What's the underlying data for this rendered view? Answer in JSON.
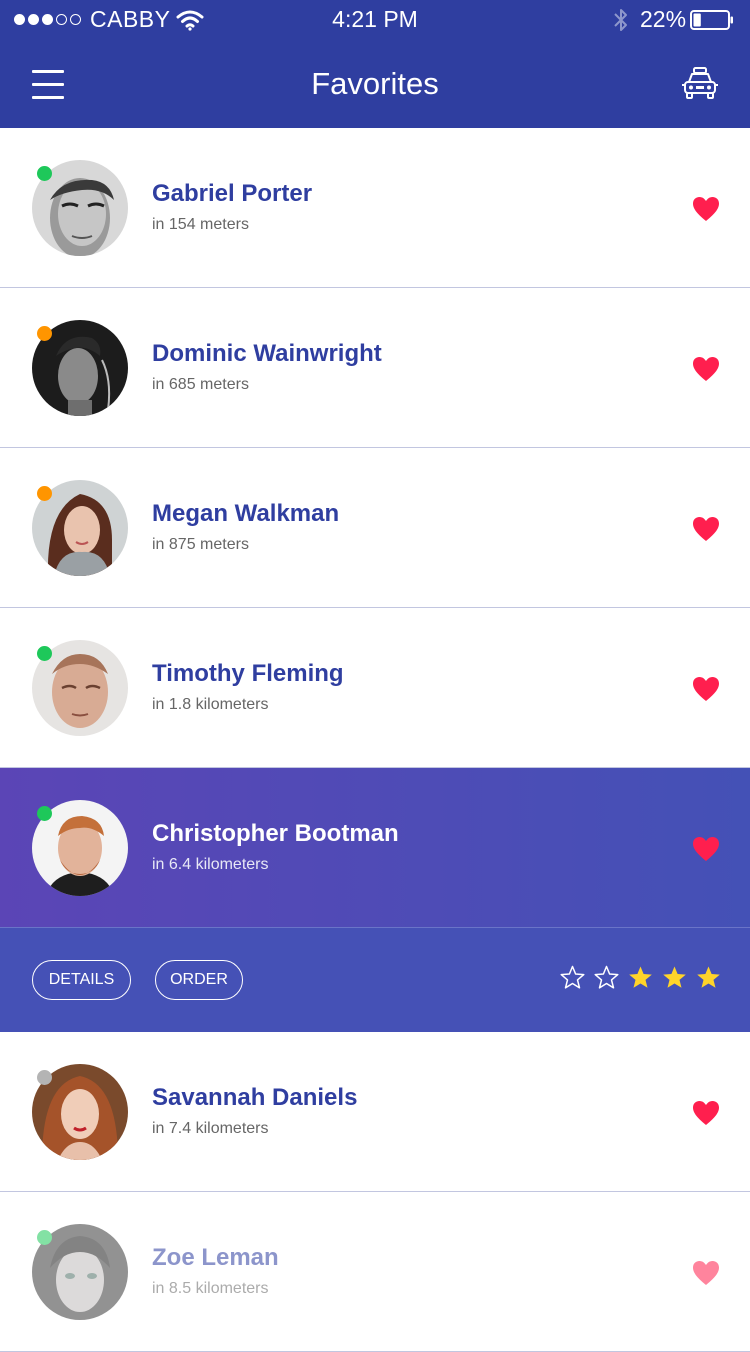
{
  "status_bar": {
    "signal_dots": [
      "full",
      "full",
      "full",
      "empty",
      "empty"
    ],
    "carrier": "CABBY",
    "time": "4:21 PM",
    "battery_percent": "22%",
    "battery_level": 0.22
  },
  "nav": {
    "title": "Favorites",
    "menu_icon": "hamburger-menu-icon",
    "right_icon": "taxi-icon"
  },
  "colors": {
    "primary": "#2f3ea0",
    "selected_gradient": [
      "#5b45b6",
      "#4451b6"
    ],
    "heart": "#ff1f4e",
    "star_filled": "#ffd42a",
    "online": "#1ec85a",
    "away": "#ff9500",
    "offline": "#b4b4b4"
  },
  "drivers": [
    {
      "name": "Gabriel Porter",
      "distance": "in 154 meters",
      "status": "online"
    },
    {
      "name": "Dominic Wainwright",
      "distance": "in 685 meters",
      "status": "away"
    },
    {
      "name": "Megan Walkman",
      "distance": "in 875 meters",
      "status": "away"
    },
    {
      "name": "Timothy Fleming",
      "distance": "in 1.8 kilometers",
      "status": "online"
    },
    {
      "name": "Christopher Bootman",
      "distance": "in 6.4 kilometers",
      "status": "online",
      "selected": true
    },
    {
      "name": "Savannah Daniels",
      "distance": "in 7.4 kilometers",
      "status": "offline"
    },
    {
      "name": "Zoe Leman",
      "distance": "in 8.5 kilometers",
      "status": "online"
    }
  ],
  "selected_actions": {
    "details_label": "DETAILS",
    "order_label": "ORDER",
    "rating": 3,
    "rating_max": 5
  }
}
